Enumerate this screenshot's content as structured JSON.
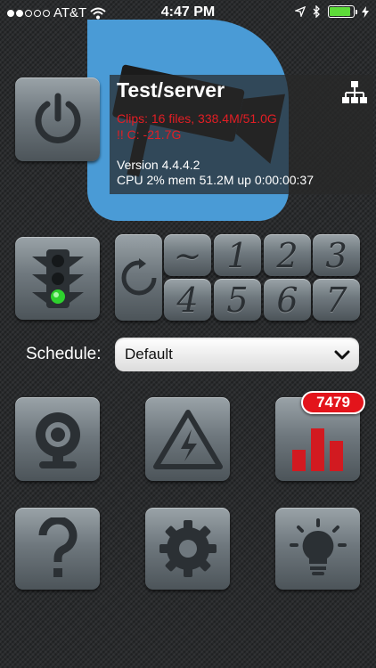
{
  "status_bar": {
    "carrier": "AT&T",
    "time": "4:47 PM",
    "signal_bars_filled": 2,
    "battery_level": 0.9
  },
  "server": {
    "title": "Test/server",
    "clips_line": "Clips: 16 files, 338.4M/51.0G",
    "warning_line": "!! C: -21.7G",
    "version_line": "Version 4.4.4.2",
    "stats_line": "CPU 2% mem 51.2M up 0:00:00:37"
  },
  "profiles": {
    "keys": [
      "~",
      "1",
      "2",
      "3",
      "4",
      "5",
      "6",
      "7"
    ]
  },
  "schedule": {
    "label": "Schedule:",
    "value": "Default"
  },
  "alerts": {
    "badge_count": "7479"
  },
  "colors": {
    "accent_blue": "#4a9bd6",
    "alert_red": "#e31e24",
    "traffic_green": "#2ed12e",
    "battery_green": "#5ddb39"
  },
  "icons": {
    "power": "power-icon",
    "network": "network-icon",
    "traffic_light": "traffic-light-icon",
    "refresh": "refresh-icon",
    "camera": "webcam-icon",
    "warning": "high-voltage-warning-icon",
    "chart": "bar-chart-icon",
    "help": "question-mark-icon",
    "settings": "gear-icon",
    "tips": "lightbulb-icon"
  }
}
